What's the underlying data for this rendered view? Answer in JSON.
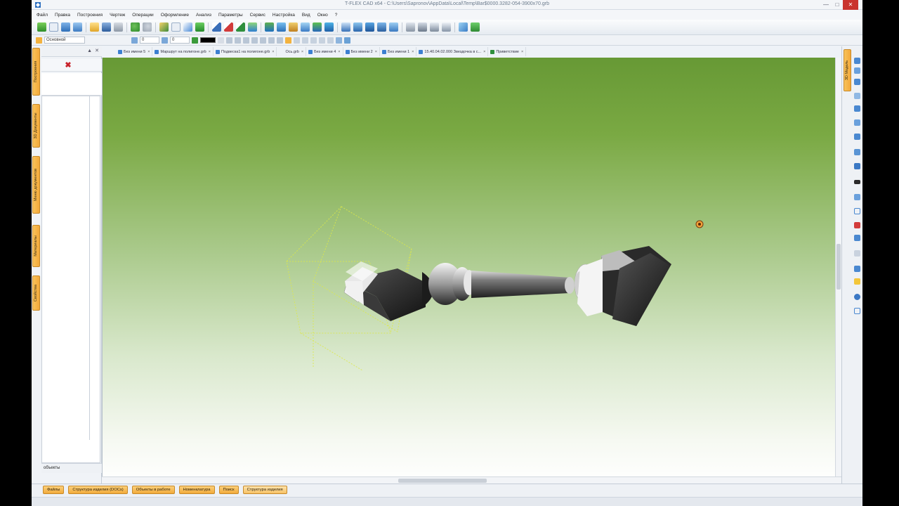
{
  "window": {
    "title": "T-FLEX CAD x64 - C:\\Users\\Sapronov\\AppData\\Local\\Temp\\Bar$0000.3282-054-3900х70.grb"
  },
  "menu": [
    "Файл",
    "Правка",
    "Построения",
    "Чертеж",
    "Операции",
    "Оформление",
    "Анализ",
    "Параметры",
    "Сервис",
    "Настройка",
    "Вид",
    "Окно",
    "?"
  ],
  "toolbar2": {
    "layer": "Основной",
    "field1": "0",
    "field2": "0"
  },
  "left_panel": {
    "vertical_tabs": [
      "Построения",
      "3D Документы",
      "Меню документов",
      "Материалы",
      "Свойства"
    ],
    "objects_label": "объекты"
  },
  "doc_tabs": [
    "Без имени 5",
    "Маршрут на полигоне.grb",
    "Подвеска1 на полигоне.grb",
    "Ось.grb",
    "Без имени 4",
    "Без имени 2",
    "Без имени 1",
    "15.40.04.02.000 Звездочка в с...",
    "Приветствие"
  ],
  "right_panel": {
    "tab": "3D Модель"
  },
  "bottom_tabs": [
    "Файлы",
    "Структура изделия (DOCs)",
    "Объекты в работе",
    "Номенклатура",
    "Поиск",
    "Структура изделия"
  ],
  "colors": {
    "accent_orange": "#f3a93a",
    "viewport_top": "#679935",
    "viewport_bottom": "#ffffff",
    "selection_yellow": "#e2ec4a"
  }
}
